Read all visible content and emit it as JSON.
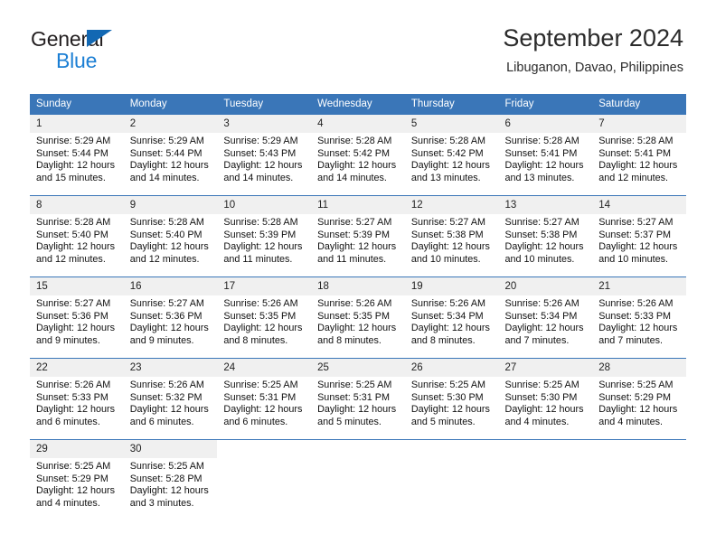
{
  "brand": {
    "name_top": "General",
    "name_bottom": "Blue",
    "triangle_color": "#1268b3",
    "blue_text_color": "#1c7fd4"
  },
  "header": {
    "title": "September 2024",
    "subtitle": "Libuganon, Davao, Philippines"
  },
  "theme": {
    "header_bg": "#3a76b8",
    "header_text": "#ffffff",
    "daynum_bg": "#f0f0f0",
    "rule_color": "#3a76b8"
  },
  "weekdays": [
    "Sunday",
    "Monday",
    "Tuesday",
    "Wednesday",
    "Thursday",
    "Friday",
    "Saturday"
  ],
  "weeks": [
    [
      {
        "day": "1",
        "sunrise": "Sunrise: 5:29 AM",
        "sunset": "Sunset: 5:44 PM",
        "daylight1": "Daylight: 12 hours",
        "daylight2": "and 15 minutes."
      },
      {
        "day": "2",
        "sunrise": "Sunrise: 5:29 AM",
        "sunset": "Sunset: 5:44 PM",
        "daylight1": "Daylight: 12 hours",
        "daylight2": "and 14 minutes."
      },
      {
        "day": "3",
        "sunrise": "Sunrise: 5:29 AM",
        "sunset": "Sunset: 5:43 PM",
        "daylight1": "Daylight: 12 hours",
        "daylight2": "and 14 minutes."
      },
      {
        "day": "4",
        "sunrise": "Sunrise: 5:28 AM",
        "sunset": "Sunset: 5:42 PM",
        "daylight1": "Daylight: 12 hours",
        "daylight2": "and 14 minutes."
      },
      {
        "day": "5",
        "sunrise": "Sunrise: 5:28 AM",
        "sunset": "Sunset: 5:42 PM",
        "daylight1": "Daylight: 12 hours",
        "daylight2": "and 13 minutes."
      },
      {
        "day": "6",
        "sunrise": "Sunrise: 5:28 AM",
        "sunset": "Sunset: 5:41 PM",
        "daylight1": "Daylight: 12 hours",
        "daylight2": "and 13 minutes."
      },
      {
        "day": "7",
        "sunrise": "Sunrise: 5:28 AM",
        "sunset": "Sunset: 5:41 PM",
        "daylight1": "Daylight: 12 hours",
        "daylight2": "and 12 minutes."
      }
    ],
    [
      {
        "day": "8",
        "sunrise": "Sunrise: 5:28 AM",
        "sunset": "Sunset: 5:40 PM",
        "daylight1": "Daylight: 12 hours",
        "daylight2": "and 12 minutes."
      },
      {
        "day": "9",
        "sunrise": "Sunrise: 5:28 AM",
        "sunset": "Sunset: 5:40 PM",
        "daylight1": "Daylight: 12 hours",
        "daylight2": "and 12 minutes."
      },
      {
        "day": "10",
        "sunrise": "Sunrise: 5:28 AM",
        "sunset": "Sunset: 5:39 PM",
        "daylight1": "Daylight: 12 hours",
        "daylight2": "and 11 minutes."
      },
      {
        "day": "11",
        "sunrise": "Sunrise: 5:27 AM",
        "sunset": "Sunset: 5:39 PM",
        "daylight1": "Daylight: 12 hours",
        "daylight2": "and 11 minutes."
      },
      {
        "day": "12",
        "sunrise": "Sunrise: 5:27 AM",
        "sunset": "Sunset: 5:38 PM",
        "daylight1": "Daylight: 12 hours",
        "daylight2": "and 10 minutes."
      },
      {
        "day": "13",
        "sunrise": "Sunrise: 5:27 AM",
        "sunset": "Sunset: 5:38 PM",
        "daylight1": "Daylight: 12 hours",
        "daylight2": "and 10 minutes."
      },
      {
        "day": "14",
        "sunrise": "Sunrise: 5:27 AM",
        "sunset": "Sunset: 5:37 PM",
        "daylight1": "Daylight: 12 hours",
        "daylight2": "and 10 minutes."
      }
    ],
    [
      {
        "day": "15",
        "sunrise": "Sunrise: 5:27 AM",
        "sunset": "Sunset: 5:36 PM",
        "daylight1": "Daylight: 12 hours",
        "daylight2": "and 9 minutes."
      },
      {
        "day": "16",
        "sunrise": "Sunrise: 5:27 AM",
        "sunset": "Sunset: 5:36 PM",
        "daylight1": "Daylight: 12 hours",
        "daylight2": "and 9 minutes."
      },
      {
        "day": "17",
        "sunrise": "Sunrise: 5:26 AM",
        "sunset": "Sunset: 5:35 PM",
        "daylight1": "Daylight: 12 hours",
        "daylight2": "and 8 minutes."
      },
      {
        "day": "18",
        "sunrise": "Sunrise: 5:26 AM",
        "sunset": "Sunset: 5:35 PM",
        "daylight1": "Daylight: 12 hours",
        "daylight2": "and 8 minutes."
      },
      {
        "day": "19",
        "sunrise": "Sunrise: 5:26 AM",
        "sunset": "Sunset: 5:34 PM",
        "daylight1": "Daylight: 12 hours",
        "daylight2": "and 8 minutes."
      },
      {
        "day": "20",
        "sunrise": "Sunrise: 5:26 AM",
        "sunset": "Sunset: 5:34 PM",
        "daylight1": "Daylight: 12 hours",
        "daylight2": "and 7 minutes."
      },
      {
        "day": "21",
        "sunrise": "Sunrise: 5:26 AM",
        "sunset": "Sunset: 5:33 PM",
        "daylight1": "Daylight: 12 hours",
        "daylight2": "and 7 minutes."
      }
    ],
    [
      {
        "day": "22",
        "sunrise": "Sunrise: 5:26 AM",
        "sunset": "Sunset: 5:33 PM",
        "daylight1": "Daylight: 12 hours",
        "daylight2": "and 6 minutes."
      },
      {
        "day": "23",
        "sunrise": "Sunrise: 5:26 AM",
        "sunset": "Sunset: 5:32 PM",
        "daylight1": "Daylight: 12 hours",
        "daylight2": "and 6 minutes."
      },
      {
        "day": "24",
        "sunrise": "Sunrise: 5:25 AM",
        "sunset": "Sunset: 5:31 PM",
        "daylight1": "Daylight: 12 hours",
        "daylight2": "and 6 minutes."
      },
      {
        "day": "25",
        "sunrise": "Sunrise: 5:25 AM",
        "sunset": "Sunset: 5:31 PM",
        "daylight1": "Daylight: 12 hours",
        "daylight2": "and 5 minutes."
      },
      {
        "day": "26",
        "sunrise": "Sunrise: 5:25 AM",
        "sunset": "Sunset: 5:30 PM",
        "daylight1": "Daylight: 12 hours",
        "daylight2": "and 5 minutes."
      },
      {
        "day": "27",
        "sunrise": "Sunrise: 5:25 AM",
        "sunset": "Sunset: 5:30 PM",
        "daylight1": "Daylight: 12 hours",
        "daylight2": "and 4 minutes."
      },
      {
        "day": "28",
        "sunrise": "Sunrise: 5:25 AM",
        "sunset": "Sunset: 5:29 PM",
        "daylight1": "Daylight: 12 hours",
        "daylight2": "and 4 minutes."
      }
    ],
    [
      {
        "day": "29",
        "sunrise": "Sunrise: 5:25 AM",
        "sunset": "Sunset: 5:29 PM",
        "daylight1": "Daylight: 12 hours",
        "daylight2": "and 4 minutes."
      },
      {
        "day": "30",
        "sunrise": "Sunrise: 5:25 AM",
        "sunset": "Sunset: 5:28 PM",
        "daylight1": "Daylight: 12 hours",
        "daylight2": "and 3 minutes."
      },
      {
        "day": "",
        "sunrise": "",
        "sunset": "",
        "daylight1": "",
        "daylight2": ""
      },
      {
        "day": "",
        "sunrise": "",
        "sunset": "",
        "daylight1": "",
        "daylight2": ""
      },
      {
        "day": "",
        "sunrise": "",
        "sunset": "",
        "daylight1": "",
        "daylight2": ""
      },
      {
        "day": "",
        "sunrise": "",
        "sunset": "",
        "daylight1": "",
        "daylight2": ""
      },
      {
        "day": "",
        "sunrise": "",
        "sunset": "",
        "daylight1": "",
        "daylight2": ""
      }
    ]
  ]
}
